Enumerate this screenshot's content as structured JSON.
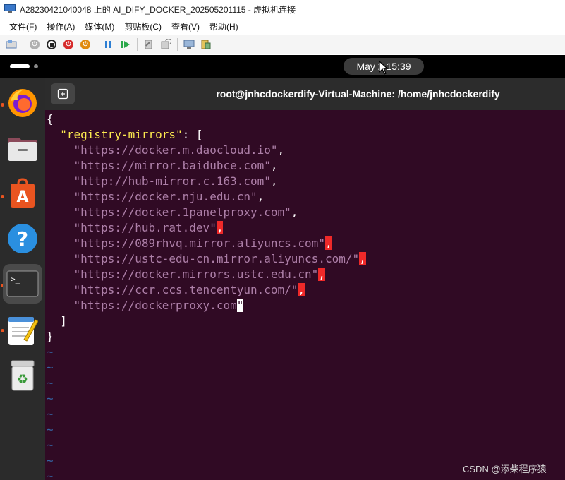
{
  "window": {
    "title": "A28230421040048 上的 AI_DIFY_DOCKER_202505201115 - 虚拟机连接"
  },
  "menu": [
    "文件(F)",
    "操作(A)",
    "媒体(M)",
    "剪贴板(C)",
    "查看(V)",
    "帮助(H)"
  ],
  "toolbar": {
    "icons": [
      "ctrl-alt-del-icon",
      "start-icon",
      "turn-off-icon",
      "shutdown-icon",
      "power-reset-icon",
      "pause-icon",
      "resume-icon",
      "revert-icon",
      "checkpoint-icon",
      "enhanced-session-icon",
      "share-icon"
    ]
  },
  "topbar": {
    "clock": "May 2  15:39"
  },
  "dock": {
    "apps": [
      "firefox-icon",
      "files-icon",
      "app-center-icon",
      "help-icon",
      "terminal-icon",
      "text-editor-icon",
      "trash-icon"
    ]
  },
  "terminal": {
    "title": "root@jnhcdockerdify-Virtual-Machine: /home/jnhcdockerdify",
    "lines": {
      "open_brace": "{",
      "key": "\"registry-mirrors\"",
      "key_tail": ": [",
      "m1": "\"https://docker.m.daocloud.io\"",
      "m2": "\"https://mirror.baidubce.com\"",
      "m3": "\"http://hub-mirror.c.163.com\"",
      "m4": "\"https://docker.nju.edu.cn\"",
      "m5": "\"https://docker.1panelproxy.com\"",
      "m6": "\"https://hub.rat.dev\"",
      "m7": "\"https://089rhvq.mirror.aliyuncs.com\"",
      "m8": "\"https://ustc-edu-cn.mirror.aliyuncs.com/\"",
      "m9": "\"https://docker.mirrors.ustc.edu.cn\"",
      "m10": "\"https://ccr.ccs.tencentyun.com/\"",
      "m11": "\"https://dockerproxy.com",
      "m11_cursor": "\"",
      "comma": ",",
      "close_bracket": "]",
      "close_brace": "}",
      "tilde": "~"
    }
  },
  "watermark": "CSDN @添柴程序猿"
}
